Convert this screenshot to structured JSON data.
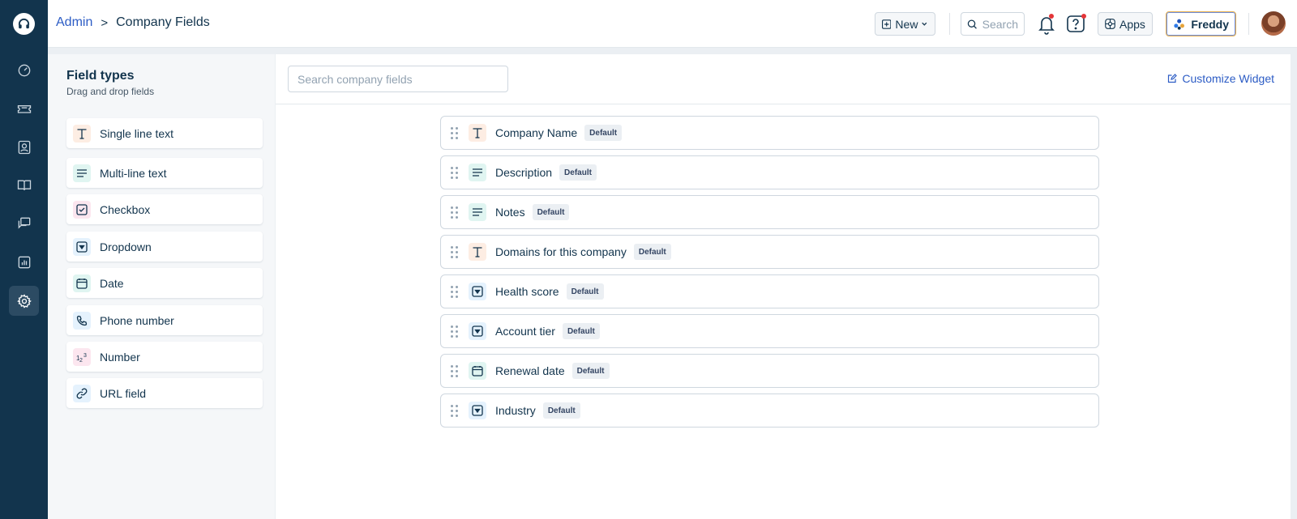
{
  "nav": {
    "items": [
      {
        "name": "dashboard-icon",
        "active": false
      },
      {
        "name": "tickets-icon",
        "active": false
      },
      {
        "name": "contacts-icon",
        "active": false
      },
      {
        "name": "solutions-icon",
        "active": false
      },
      {
        "name": "conversations-icon",
        "active": false
      },
      {
        "name": "reports-icon",
        "active": false
      },
      {
        "name": "admin-gear-icon",
        "active": true
      }
    ]
  },
  "header": {
    "breadcrumb_root": "Admin",
    "breadcrumb_sep": ">",
    "breadcrumb_current": "Company Fields",
    "new_label": "New",
    "search_label": "Search",
    "apps_label": "Apps",
    "freddy_label": "Freddy"
  },
  "field_types": {
    "title": "Field types",
    "subtitle": "Drag and drop fields",
    "items": [
      {
        "label": "Single line text",
        "icon": "text-icon"
      },
      {
        "label": "Multi-line text",
        "icon": "paragraph-icon"
      },
      {
        "label": "Checkbox",
        "icon": "checkbox-icon"
      },
      {
        "label": "Dropdown",
        "icon": "dropdown-icon"
      },
      {
        "label": "Date",
        "icon": "calendar-icon"
      },
      {
        "label": "Phone number",
        "icon": "phone-icon"
      },
      {
        "label": "Number",
        "icon": "number-icon"
      },
      {
        "label": "URL field",
        "icon": "link-icon"
      }
    ]
  },
  "main": {
    "search_placeholder": "Search company fields",
    "customize_label": "Customize Widget",
    "fields": [
      {
        "label": "Company Name",
        "badge": "Default",
        "icon": "text-icon"
      },
      {
        "label": "Description",
        "badge": "Default",
        "icon": "paragraph-icon"
      },
      {
        "label": "Notes",
        "badge": "Default",
        "icon": "paragraph-icon"
      },
      {
        "label": "Domains for this company",
        "badge": "Default",
        "icon": "text-icon"
      },
      {
        "label": "Health score",
        "badge": "Default",
        "icon": "dropdown-icon"
      },
      {
        "label": "Account tier",
        "badge": "Default",
        "icon": "dropdown-icon"
      },
      {
        "label": "Renewal date",
        "badge": "Default",
        "icon": "calendar-icon"
      },
      {
        "label": "Industry",
        "badge": "Default",
        "icon": "dropdown-icon"
      }
    ]
  },
  "colors": {
    "nav_bg": "#12344d",
    "link": "#2c5cc5",
    "notification": "#e43538"
  }
}
